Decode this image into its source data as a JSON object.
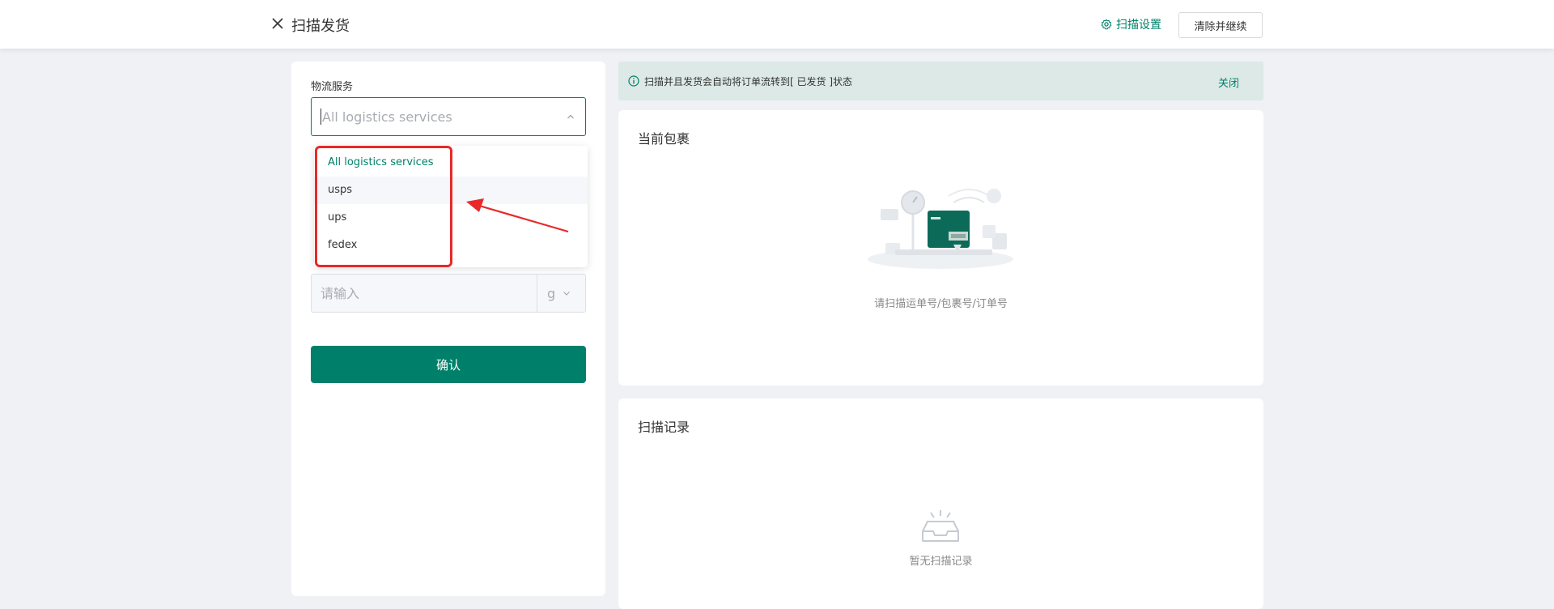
{
  "header": {
    "title": "扫描发货",
    "scan_settings": "扫描设置",
    "clear_continue": "清除并继续"
  },
  "form": {
    "logistics_label": "物流服务",
    "logistics_placeholder": "All logistics services",
    "dropdown_options": [
      "All logistics services",
      "usps",
      "ups",
      "fedex"
    ],
    "weight_placeholder": "请输入",
    "weight_unit": "g",
    "confirm": "确认"
  },
  "notice": {
    "text_prefix": "扫描并且发货会自动将订单流转到",
    "status": "[ 已发货 ]",
    "text_suffix": "状态",
    "close": "关闭"
  },
  "current_package": {
    "title": "当前包裹",
    "empty_text": "请扫描运单号/包裹号/订单号"
  },
  "scan_log": {
    "title": "扫描记录",
    "empty_text": "暂无扫描记录"
  },
  "colors": {
    "primary": "#00806a",
    "annotation_red": "#e82929"
  }
}
